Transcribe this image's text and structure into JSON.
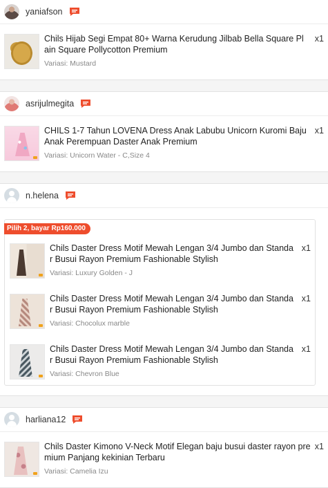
{
  "orders": [
    {
      "buyer": "yaniafson",
      "items": [
        {
          "title": "Chils Hijab Segi Empat 80+ Warna Kerudung Jilbab Bella Square Pl ain Square Pollycotton Premium",
          "variant": "Variasi: Mustard",
          "qty": "x1"
        }
      ]
    },
    {
      "buyer": "asrijulmegita",
      "items": [
        {
          "title": "CHILS 1-7 Tahun LOVENA Dress Anak Labubu Unicorn Kuromi Baju Anak Perempuan Daster Anak Premium",
          "variant": "Variasi: Unicorn Water - C,Size 4",
          "qty": "x1"
        }
      ]
    },
    {
      "buyer": "n.helena",
      "bundle_label": "Pilih 2, bayar Rp160.000",
      "items": [
        {
          "title": "Chils Daster Dress Motif Mewah Lengan 3/4 Jumbo dan Standa r Busui Rayon Premium Fashionable Stylish",
          "variant": "Variasi: Luxury Golden - J",
          "qty": "x1"
        },
        {
          "title": "Chils Daster Dress Motif Mewah Lengan 3/4 Jumbo dan Standa r Busui Rayon Premium Fashionable Stylish",
          "variant": "Variasi: Chocolux marble",
          "qty": "x1"
        },
        {
          "title": "Chils Daster Dress Motif Mewah Lengan 3/4 Jumbo dan Standa r Busui Rayon Premium Fashionable Stylish",
          "variant": "Variasi: Chevron Blue",
          "qty": "x1"
        }
      ]
    },
    {
      "buyer": "harliana12",
      "items": [
        {
          "title": "Chils Daster Kimono V-Neck Motif Elegan baju busui daster rayon premium Panjang kekinian Terbaru",
          "variant": "Variasi: Camelia Izu",
          "qty": "x1"
        }
      ]
    }
  ],
  "icons": {
    "chat": "chat-bubble-icon",
    "avatar_default": "user-silhouette-icon"
  },
  "colors": {
    "accent": "#ee4d2d",
    "background": "#f5f5f5",
    "variant_text": "#888888"
  }
}
